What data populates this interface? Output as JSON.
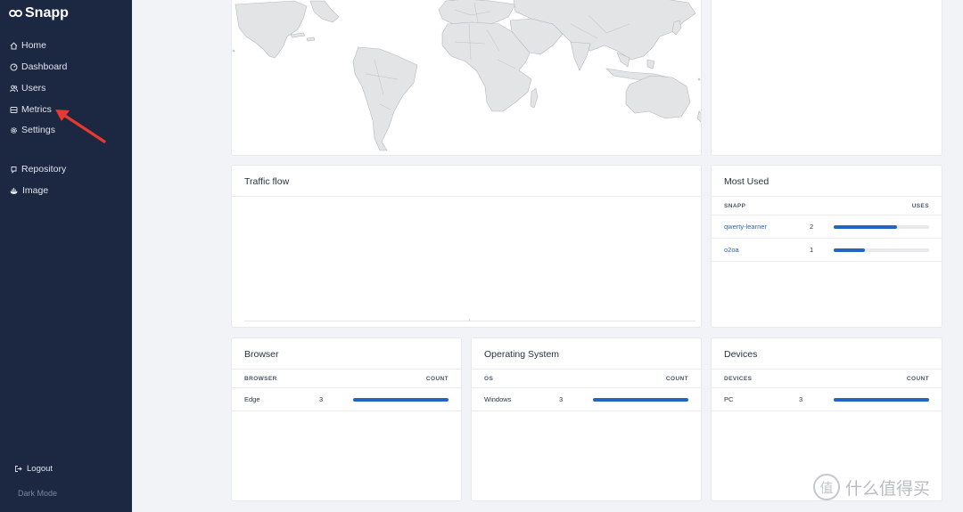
{
  "app": {
    "name": "Snapp"
  },
  "sidebar": {
    "items": [
      {
        "label": "Home",
        "icon": "home-icon"
      },
      {
        "label": "Dashboard",
        "icon": "dashboard-icon"
      },
      {
        "label": "Users",
        "icon": "users-icon"
      },
      {
        "label": "Metrics",
        "icon": "metrics-icon"
      },
      {
        "label": "Settings",
        "icon": "gear-icon"
      },
      {
        "label": "Repository",
        "icon": "github-icon"
      },
      {
        "label": "Image",
        "icon": "docker-icon"
      }
    ],
    "logout_label": "Logout",
    "dark_mode_label": "Dark Mode"
  },
  "traffic": {
    "title": "Traffic flow"
  },
  "most_used": {
    "title": "Most Used",
    "col_left": "SNAPP",
    "col_right": "USES",
    "rows": [
      {
        "name": "qwerty-learner",
        "count": "2",
        "fraction": 0.66
      },
      {
        "name": "o2oa",
        "count": "1",
        "fraction": 0.33
      }
    ]
  },
  "browser": {
    "title": "Browser",
    "col_left": "BROWSER",
    "col_right": "COUNT",
    "rows": [
      {
        "name": "Edge",
        "count": "3",
        "fraction": 1.0
      }
    ]
  },
  "os": {
    "title": "Operating System",
    "col_left": "OS",
    "col_right": "COUNT",
    "rows": [
      {
        "name": "Windows",
        "count": "3",
        "fraction": 1.0
      }
    ]
  },
  "devices": {
    "title": "Devices",
    "col_left": "DEVICES",
    "col_right": "COUNT",
    "rows": [
      {
        "name": "PC",
        "count": "3",
        "fraction": 1.0
      }
    ]
  },
  "watermark": {
    "text": "什么值得买",
    "glyph": "值"
  },
  "colors": {
    "sidebar": "#1c2842",
    "accent": "#2266c4",
    "annotation_arrow": "#e8392f"
  }
}
